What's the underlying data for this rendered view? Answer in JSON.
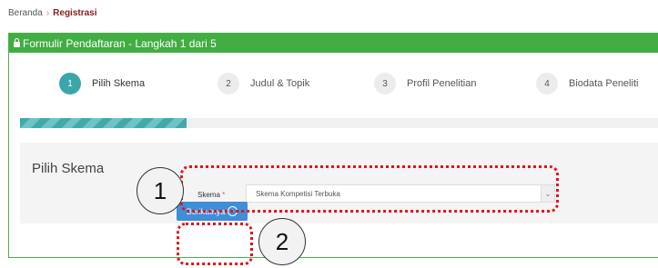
{
  "breadcrumb": {
    "home": "Beranda",
    "separator": "›",
    "current": "Registrasi"
  },
  "panel": {
    "title": "Formulir Pendaftaran - Langkah 1 dari 5"
  },
  "steps": [
    {
      "number": "1",
      "label": "Pilih Skema",
      "active": true
    },
    {
      "number": "2",
      "label": "Judul & Topik",
      "active": false
    },
    {
      "number": "3",
      "label": "Profil Penelitian",
      "active": false
    },
    {
      "number": "4",
      "label": "Biodata Peneliti",
      "active": false
    }
  ],
  "progress": {
    "fraction": 0.26,
    "color": "#41a9ab"
  },
  "form": {
    "section_title": "Pilih Skema",
    "field_label": "Skema",
    "required_mark": "*",
    "selected_value": "Skema Kompetisi Terbuka"
  },
  "buttons": {
    "next_label": "Berikutnya"
  },
  "annotations": {
    "callout_1": "1",
    "callout_2": "2",
    "highlight_color": "#e0141b"
  },
  "colors": {
    "header_green": "#42ad42",
    "button_blue": "#3f8ed8",
    "breadcrumb_current": "#8b1a1a"
  }
}
